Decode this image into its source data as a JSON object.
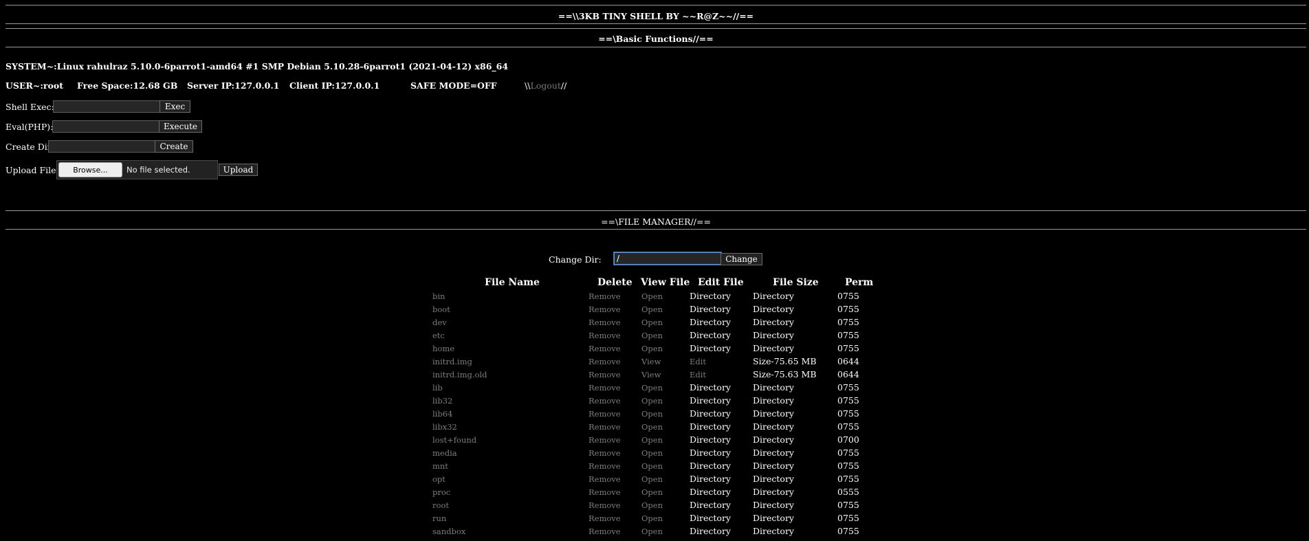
{
  "header": {
    "title": "==\\\\3KB TINY SHELL BY ~~R@Z~~//==",
    "basic_functions": "==\\Basic Functions//=="
  },
  "system": {
    "uname": "SYSTEM~:Linux rahulraz 5.10.0-6parrot1-amd64 #1 SMP Debian 5.10.28-6parrot1 (2021-04-12) x86_64",
    "user": "USER~:root",
    "free_space": "Free Space:12.68 GB",
    "server_ip": "Server IP:127.0.0.1",
    "client_ip": "Client IP:127.0.0.1",
    "safe_mode": "SAFE MODE=OFF",
    "logout_prefix": "\\\\",
    "logout_label": "Logout",
    "logout_suffix": "//"
  },
  "forms": {
    "shell_exec": {
      "label": "Shell Exec:",
      "value": "",
      "button": "Exec"
    },
    "eval_php": {
      "label": "Eval(PHP):",
      "value": "",
      "button": "Execute"
    },
    "create_dir": {
      "label": "Create Dir:",
      "value": "",
      "button": "Create"
    },
    "upload": {
      "label": "Upload File:",
      "browse": "Browse...",
      "file_status": "No file selected.",
      "button": "Upload"
    }
  },
  "file_manager": {
    "title": "==\\FILE MANAGER//==",
    "change_dir_label": "Change Dir:",
    "change_dir_value": "/",
    "change_button": "Change",
    "columns": [
      "File Name",
      "Delete",
      "View File",
      "Edit File",
      "File Size",
      "Perm"
    ],
    "rows": [
      {
        "name": "bin",
        "delete": "Remove",
        "view": "Open",
        "edit": "Directory",
        "size": "Directory",
        "perm": "0755"
      },
      {
        "name": "boot",
        "delete": "Remove",
        "view": "Open",
        "edit": "Directory",
        "size": "Directory",
        "perm": "0755"
      },
      {
        "name": "dev",
        "delete": "Remove",
        "view": "Open",
        "edit": "Directory",
        "size": "Directory",
        "perm": "0755"
      },
      {
        "name": "etc",
        "delete": "Remove",
        "view": "Open",
        "edit": "Directory",
        "size": "Directory",
        "perm": "0755"
      },
      {
        "name": "home",
        "delete": "Remove",
        "view": "Open",
        "edit": "Directory",
        "size": "Directory",
        "perm": "0755"
      },
      {
        "name": "initrd.img",
        "delete": "Remove",
        "view": "View",
        "edit": "Edit",
        "size": "Size-75.65 MB",
        "perm": "0644"
      },
      {
        "name": "initrd.img.old",
        "delete": "Remove",
        "view": "View",
        "edit": "Edit",
        "size": "Size-75.63 MB",
        "perm": "0644"
      },
      {
        "name": "lib",
        "delete": "Remove",
        "view": "Open",
        "edit": "Directory",
        "size": "Directory",
        "perm": "0755"
      },
      {
        "name": "lib32",
        "delete": "Remove",
        "view": "Open",
        "edit": "Directory",
        "size": "Directory",
        "perm": "0755"
      },
      {
        "name": "lib64",
        "delete": "Remove",
        "view": "Open",
        "edit": "Directory",
        "size": "Directory",
        "perm": "0755"
      },
      {
        "name": "libx32",
        "delete": "Remove",
        "view": "Open",
        "edit": "Directory",
        "size": "Directory",
        "perm": "0755"
      },
      {
        "name": "lost+found",
        "delete": "Remove",
        "view": "Open",
        "edit": "Directory",
        "size": "Directory",
        "perm": "0700"
      },
      {
        "name": "media",
        "delete": "Remove",
        "view": "Open",
        "edit": "Directory",
        "size": "Directory",
        "perm": "0755"
      },
      {
        "name": "mnt",
        "delete": "Remove",
        "view": "Open",
        "edit": "Directory",
        "size": "Directory",
        "perm": "0755"
      },
      {
        "name": "opt",
        "delete": "Remove",
        "view": "Open",
        "edit": "Directory",
        "size": "Directory",
        "perm": "0755"
      },
      {
        "name": "proc",
        "delete": "Remove",
        "view": "Open",
        "edit": "Directory",
        "size": "Directory",
        "perm": "0555"
      },
      {
        "name": "root",
        "delete": "Remove",
        "view": "Open",
        "edit": "Directory",
        "size": "Directory",
        "perm": "0755"
      },
      {
        "name": "run",
        "delete": "Remove",
        "view": "Open",
        "edit": "Directory",
        "size": "Directory",
        "perm": "0755"
      },
      {
        "name": "sandbox",
        "delete": "Remove",
        "view": "Open",
        "edit": "Directory",
        "size": "Directory",
        "perm": "0755"
      }
    ]
  }
}
